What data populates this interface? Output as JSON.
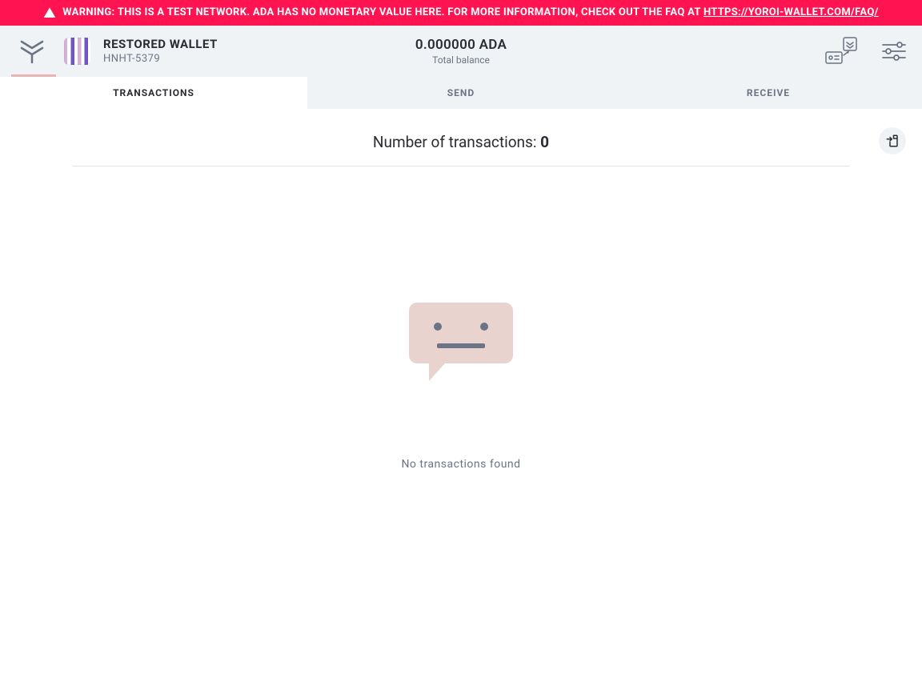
{
  "warning": {
    "prefix": "WARNING: THIS IS A TEST NETWORK. ADA HAS NO MONETARY VALUE HERE. FOR MORE INFORMATION, CHECK OUT THE FAQ AT ",
    "link_text": "HTTPS://YOROI-WALLET.COM/FAQ/"
  },
  "wallet": {
    "name": "RESTORED WALLET",
    "id": "HNHT-5379"
  },
  "balance": {
    "amount": "0.000000 ADA",
    "label": "Total balance"
  },
  "tabs": {
    "transactions": "TRANSACTIONS",
    "send": "SEND",
    "receive": "RECEIVE"
  },
  "transactions": {
    "label": "Number of transactions: ",
    "count": "0",
    "empty_message": "No transactions found"
  }
}
